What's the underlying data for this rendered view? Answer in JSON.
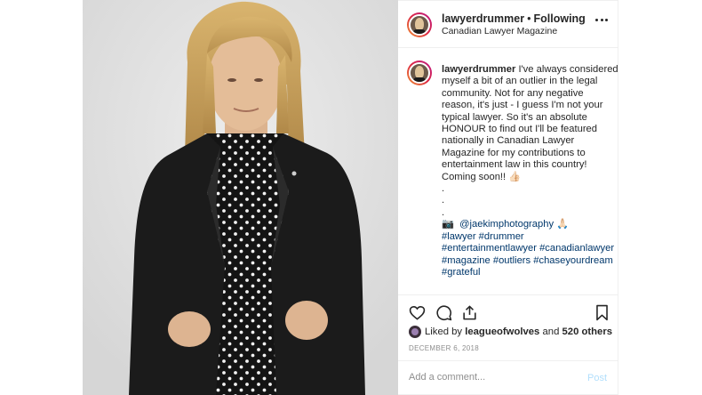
{
  "post": {
    "username": "lawyerdrummer",
    "separator": "•",
    "follow_status": "Following",
    "location": "Canadian Lawyer Magazine",
    "caption": {
      "username": "lawyerdrummer",
      "lines": [
        "I've always considered",
        "myself a bit of an outlier in the legal",
        "community. Not for any negative",
        "reason, it's just - I guess I'm not your",
        "typical lawyer. So it's an absolute",
        "HONOUR to find out I'll be featured",
        "nationally in Canadian Lawyer",
        "Magazine for my contributions to",
        "entertainment law in this country!",
        "Coming soon!! 👍🏻"
      ],
      "dots": [
        ".",
        ".",
        "."
      ],
      "credit_emoji": "📷",
      "credit_handle": "@jaekimphotography",
      "credit_suffix": "🙏🏻",
      "hashtag_lines": [
        [
          "#lawyer",
          "#drummer"
        ],
        [
          "#entertainmentlawyer",
          "#canadianlawyer"
        ],
        [
          "#magazine",
          "#outliers",
          "#chaseyourdream"
        ],
        [
          "#grateful"
        ]
      ]
    },
    "likes": {
      "prefix": "Liked by",
      "user": "leagueofwolves",
      "connector": "and",
      "others": "520 others"
    },
    "date": "DECEMBER 6, 2018",
    "comment": {
      "placeholder": "Add a comment...",
      "post_label": "Post"
    },
    "icons": {
      "like": "heart-icon",
      "comment": "comment-icon",
      "share": "share-icon",
      "save": "bookmark-icon",
      "more": "more-icon",
      "next": "chevron-right-icon"
    },
    "colors": {
      "link": "#00376b",
      "post_button": "#b2dffc",
      "muted": "#8e8e8e"
    }
  }
}
